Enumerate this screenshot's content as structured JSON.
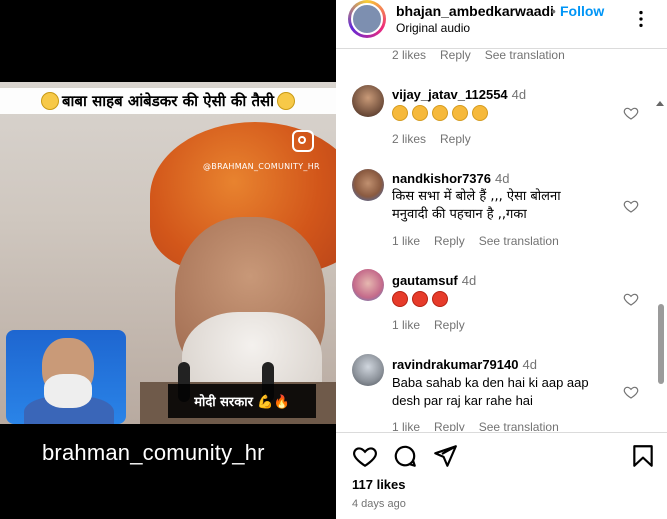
{
  "video": {
    "banner_text": "बाबा साहब आंबेडकर की ऐसी की तैसी",
    "watermark": "@BRAHMAN_COMUNITY_HR",
    "caption": "मोदी सरकार 💪🔥",
    "handle": "brahman_comunity_hr"
  },
  "header": {
    "username": "bhajan_ambedkarwaadi",
    "separator": "•",
    "follow_label": "Follow",
    "audio_label": "Original audio"
  },
  "comments": [
    {
      "meta": {
        "likes": "2 likes",
        "reply": "Reply",
        "translate": "See translation"
      }
    },
    {
      "user": "vijay_jatav_112554",
      "time": "4d",
      "reactions": [
        "sad",
        "sad",
        "sad",
        "sad",
        "sad"
      ],
      "meta": {
        "likes": "2 likes",
        "reply": "Reply"
      }
    },
    {
      "user": "nandkishor7376",
      "time": "4d",
      "text_line1": "किस सभा में बोले हैं ,,, ऐसा बोलना",
      "text_line2": "मनुवादी की पहचान है ,,गका",
      "meta": {
        "likes": "1 like",
        "reply": "Reply",
        "translate": "See translation"
      }
    },
    {
      "user": "gautamsuf",
      "time": "4d",
      "reactions": [
        "angry",
        "angry",
        "angry"
      ],
      "meta": {
        "likes": "1 like",
        "reply": "Reply"
      }
    },
    {
      "user": "ravindrakumar79140",
      "time": "4d",
      "text_line1": "Baba sahab ka den hai ki aap aap",
      "text_line2": "desh par raj kar rahe hai",
      "meta": {
        "likes": "1 like",
        "reply": "Reply",
        "translate": "See translation"
      }
    }
  ],
  "footer": {
    "likes": "117 likes",
    "ago": "4 days ago"
  },
  "icons": {
    "more": "more-icon",
    "heart": "heart-icon",
    "comment": "comment-icon",
    "share": "share-icon",
    "save": "bookmark-icon"
  }
}
